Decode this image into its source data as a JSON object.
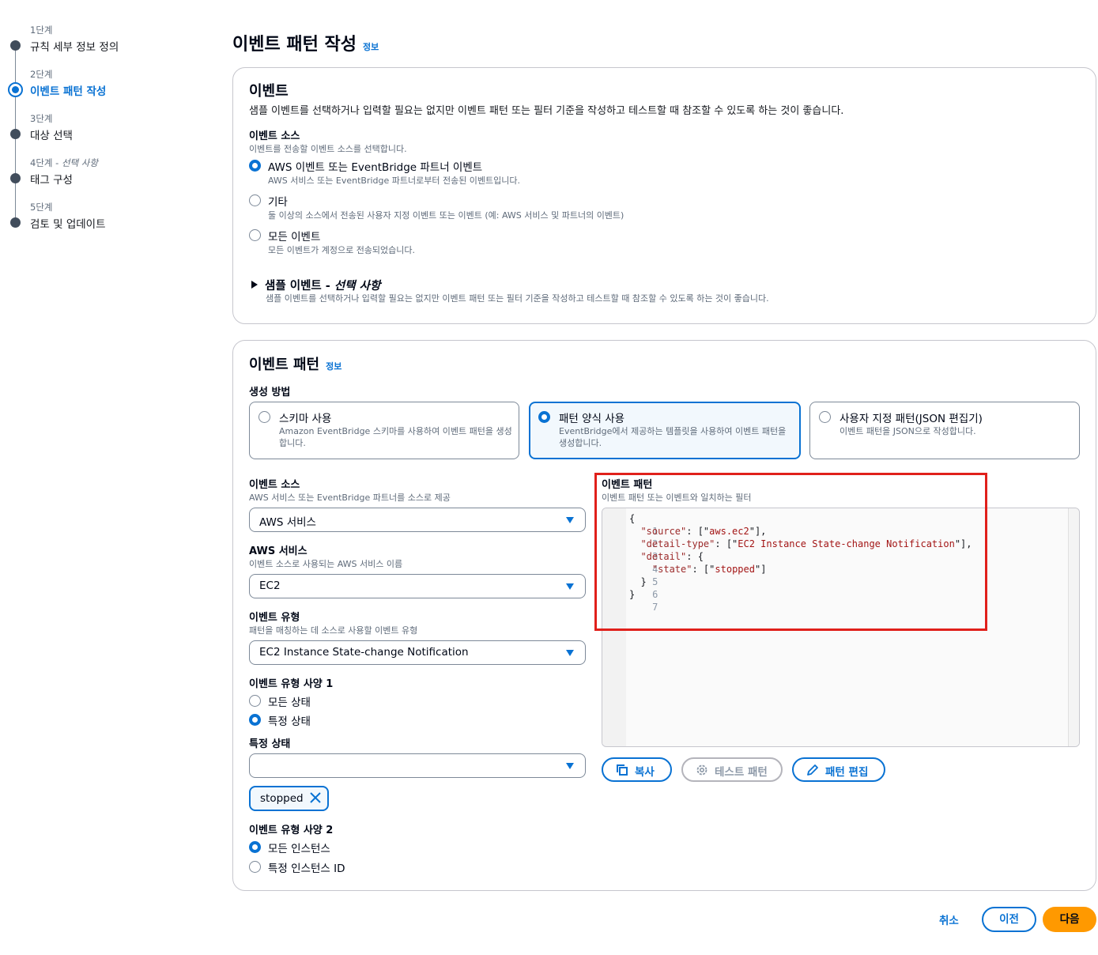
{
  "steps": [
    {
      "num": "1단계",
      "num_optional": "",
      "label": "규칙 세부 정보 정의"
    },
    {
      "num": "2단계",
      "num_optional": "",
      "label": "이벤트 패턴 작성"
    },
    {
      "num": "3단계",
      "num_optional": "",
      "label": "대상 선택"
    },
    {
      "num": "4단계 - ",
      "num_optional": "선택 사항",
      "label": "태그 구성"
    },
    {
      "num": "5단계",
      "num_optional": "",
      "label": "검토 및 업데이트"
    }
  ],
  "page": {
    "title": "이벤트 패턴 작성",
    "info": "정보"
  },
  "event_section": {
    "title": "이벤트",
    "description": "샘플 이벤트를 선택하거나 입력할 필요는 없지만 이벤트 패턴 또는 필터 기준을 작성하고 테스트할 때 참조할 수 있도록 하는 것이 좋습니다.",
    "source_label": "이벤트 소스",
    "source_desc": "이벤트를 전송할 이벤트 소스를 선택합니다.",
    "options": [
      {
        "label": "AWS 이벤트 또는 EventBridge 파트너 이벤트",
        "desc": "AWS 서비스 또는 EventBridge 파트너로부터 전송된 이벤트입니다.",
        "selected": true
      },
      {
        "label": "기타",
        "desc": "둘 이상의 소스에서 전송된 사용자 지정 이벤트 또는 이벤트 (예: AWS 서비스 및 파트너의 이벤트)",
        "selected": false
      },
      {
        "label": "모든 이벤트",
        "desc": "모든 이벤트가 계정으로 전송되었습니다.",
        "selected": false
      }
    ],
    "sample_title": "샘플 이벤트 - ",
    "sample_optional": "선택 사항",
    "sample_desc": "샘플 이벤트를 선택하거나 입력할 필요는 없지만 이벤트 패턴 또는 필터 기준을 작성하고 테스트할 때 참조할 수 있도록 하는 것이 좋습니다."
  },
  "pattern_section": {
    "title": "이벤트 패턴",
    "info": "정보",
    "method_label": "생성 방법",
    "tiles": [
      {
        "title": "스키마 사용",
        "desc": "Amazon EventBridge 스키마를 사용하여 이벤트 패턴을 생성합니다.",
        "selected": false
      },
      {
        "title": "패턴 양식 사용",
        "desc": "EventBridge에서 제공하는 템플릿을 사용하여 이벤트 패턴을 생성합니다.",
        "selected": true
      },
      {
        "title": "사용자 지정 패턴(JSON 편집기)",
        "desc": "이벤트 패턴을 JSON으로 작성합니다.",
        "selected": false
      }
    ],
    "source": {
      "label": "이벤트 소스",
      "desc": "AWS 서비스 또는 EventBridge 파트너를 소스로 제공",
      "value": "AWS 서비스"
    },
    "service": {
      "label": "AWS 서비스",
      "desc": "이벤트 소스로 사용되는 AWS 서비스 이름",
      "value": "EC2"
    },
    "event_type": {
      "label": "이벤트 유형",
      "desc": "패턴을 매칭하는 데 소스로 사용할 이벤트 유형",
      "value": "EC2 Instance State-change Notification"
    },
    "spec1": {
      "label": "이벤트 유형 사양 1",
      "options": [
        {
          "label": "모든 상태",
          "selected": false
        },
        {
          "label": "특정 상태",
          "selected": true
        }
      ]
    },
    "specific_state": {
      "label": "특정 상태",
      "value": "",
      "token": "stopped"
    },
    "spec2": {
      "label": "이벤트 유형 사양 2",
      "options": [
        {
          "label": "모든 인스턴스",
          "selected": true
        },
        {
          "label": "특정 인스턴스 ID",
          "selected": false
        }
      ]
    },
    "pattern_label": "이벤트 패턴",
    "pattern_desc": "이벤트 패턴 또는 이벤트와 일치하는 필터",
    "code_lines": [
      "{",
      "  \"source\": [\"aws.ec2\"],",
      "  \"detail-type\": [\"EC2 Instance State-change Notification\"],",
      "  \"detail\": {",
      "    \"state\": [\"stopped\"]",
      "  }",
      "}"
    ],
    "line_numbers": [
      "1",
      "2",
      "3",
      "4",
      "5",
      "6",
      "7"
    ],
    "buttons": {
      "copy": "복사",
      "test": "테스트 패턴",
      "edit": "패턴 편집"
    }
  },
  "footer": {
    "cancel": "취소",
    "prev": "이전",
    "next": "다음"
  },
  "colors": {
    "accent": "#0972d3",
    "primary_button": "#ff9900",
    "highlight": "#e0201b"
  }
}
